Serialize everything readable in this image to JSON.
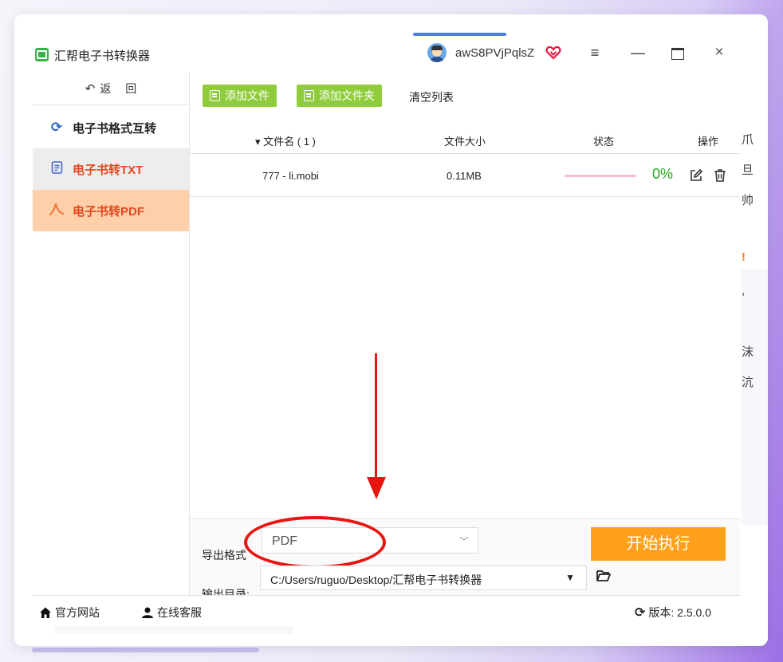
{
  "titlebar": {
    "app_title": "汇帮电子书转换器",
    "username": "awS8PVjPqlsZ",
    "menu_symbol": "≡",
    "minimize_symbol": "—",
    "close_symbol": "×"
  },
  "sidebar": {
    "back_label_1": "返",
    "back_label_2": "回",
    "items": [
      {
        "label": "电子书格式互转",
        "icon": "refresh-icon"
      },
      {
        "label": "电子书转TXT",
        "icon": "document-icon"
      },
      {
        "label": "电子书转PDF",
        "icon": "pdf-icon"
      }
    ]
  },
  "toolbar": {
    "add_file": "添加文件",
    "add_folder": "添加文件夹",
    "clear_list": "清空列表"
  },
  "table": {
    "headers": {
      "name": "▾ 文件名 ( 1 )",
      "size": "文件大小",
      "status": "状态",
      "ops": "操作"
    },
    "rows": [
      {
        "name": "777 - li.mobi",
        "size": "0.11MB",
        "progress": 0,
        "percent": "0%"
      }
    ]
  },
  "settings": {
    "format_label": "导出格式",
    "format_value": "PDF",
    "dir_label": "输出目录:",
    "dir_value": "C:/Users/ruguo/Desktop/汇帮电子书转换器",
    "start_button": "开始执行"
  },
  "footer": {
    "official_site": "官方网站",
    "online_service": "在线客服",
    "version_label": "版本: 2.5.0.0"
  },
  "ghost_text": [
    "爪",
    "旦",
    "帅",
    "!",
    ",",
    "沫",
    "沆"
  ],
  "colors": {
    "accent_green": "#8fcc3c",
    "start_orange": "#ff9f1a",
    "active_nav_bg": "#ffcfa9",
    "nav_text_red": "#e4471e",
    "annotation_red": "#e8140f",
    "percent_green": "#26a81e"
  }
}
